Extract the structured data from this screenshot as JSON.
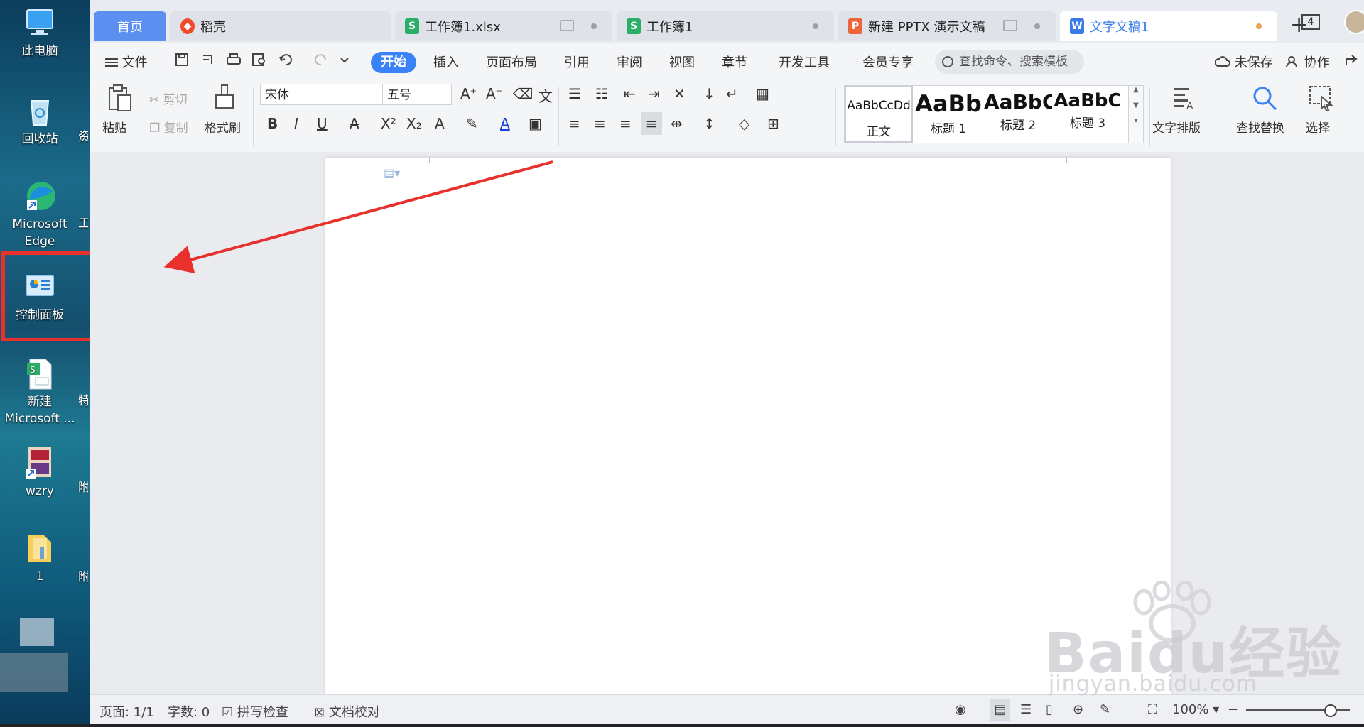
{
  "desktop": {
    "icons": [
      {
        "label": "此电脑",
        "icon": "computer-icon"
      },
      {
        "label": "回收站",
        "icon": "recycle-bin-icon"
      },
      {
        "label": "Microsoft Edge",
        "icon": "edge-icon"
      },
      {
        "label": "控制面板",
        "icon": "control-panel-icon"
      },
      {
        "label": "新建 Microsoft ...",
        "icon": "excel-file-icon"
      },
      {
        "label": "wzry",
        "icon": "app-shortcut-icon"
      },
      {
        "label": "1",
        "icon": "folder-icon"
      }
    ],
    "clipped_labels": [
      "资",
      "工",
      "特 价",
      "附 录",
      "附 录"
    ]
  },
  "tabs": [
    {
      "label": "首页"
    },
    {
      "label": "稻壳"
    },
    {
      "label": "工作簿1.xlsx"
    },
    {
      "label": "工作簿1"
    },
    {
      "label": "新建 PPTX 演示文稿"
    },
    {
      "label": "文字文稿1"
    }
  ],
  "tabbar": {
    "add_label": "+",
    "window_count": "4"
  },
  "menu": {
    "file": "文件",
    "items": [
      "开始",
      "插入",
      "页面布局",
      "引用",
      "审阅",
      "视图",
      "章节",
      "开发工具",
      "会员专享"
    ],
    "search_placeholder": "查找命令、搜索模板",
    "unsaved": "未保存",
    "collab": "协作"
  },
  "ribbon": {
    "paste": "粘贴",
    "cut": "剪切",
    "copy": "复制",
    "format_painter": "格式刷",
    "font_name": "宋体",
    "font_size": "五号",
    "styles": [
      {
        "preview": "AaBbCcDd",
        "label": "正文"
      },
      {
        "preview": "AaBb",
        "label": "标题 1"
      },
      {
        "preview": "AaBbC",
        "label": "标题 2"
      },
      {
        "preview": "AaBbC",
        "label": "标题 3"
      }
    ],
    "text_layout": "文字排版",
    "find_replace": "查找替换",
    "select": "选择"
  },
  "status": {
    "page": "页面: 1/1",
    "words": "字数: 0",
    "spell": "拼写检查",
    "proof": "文档校对",
    "zoom": "100%"
  },
  "watermark": {
    "brand": "Baidu经验",
    "url": "jingyan.baidu.com"
  },
  "colors": {
    "highlight": "#e8312c",
    "accent": "#3b82f6"
  }
}
